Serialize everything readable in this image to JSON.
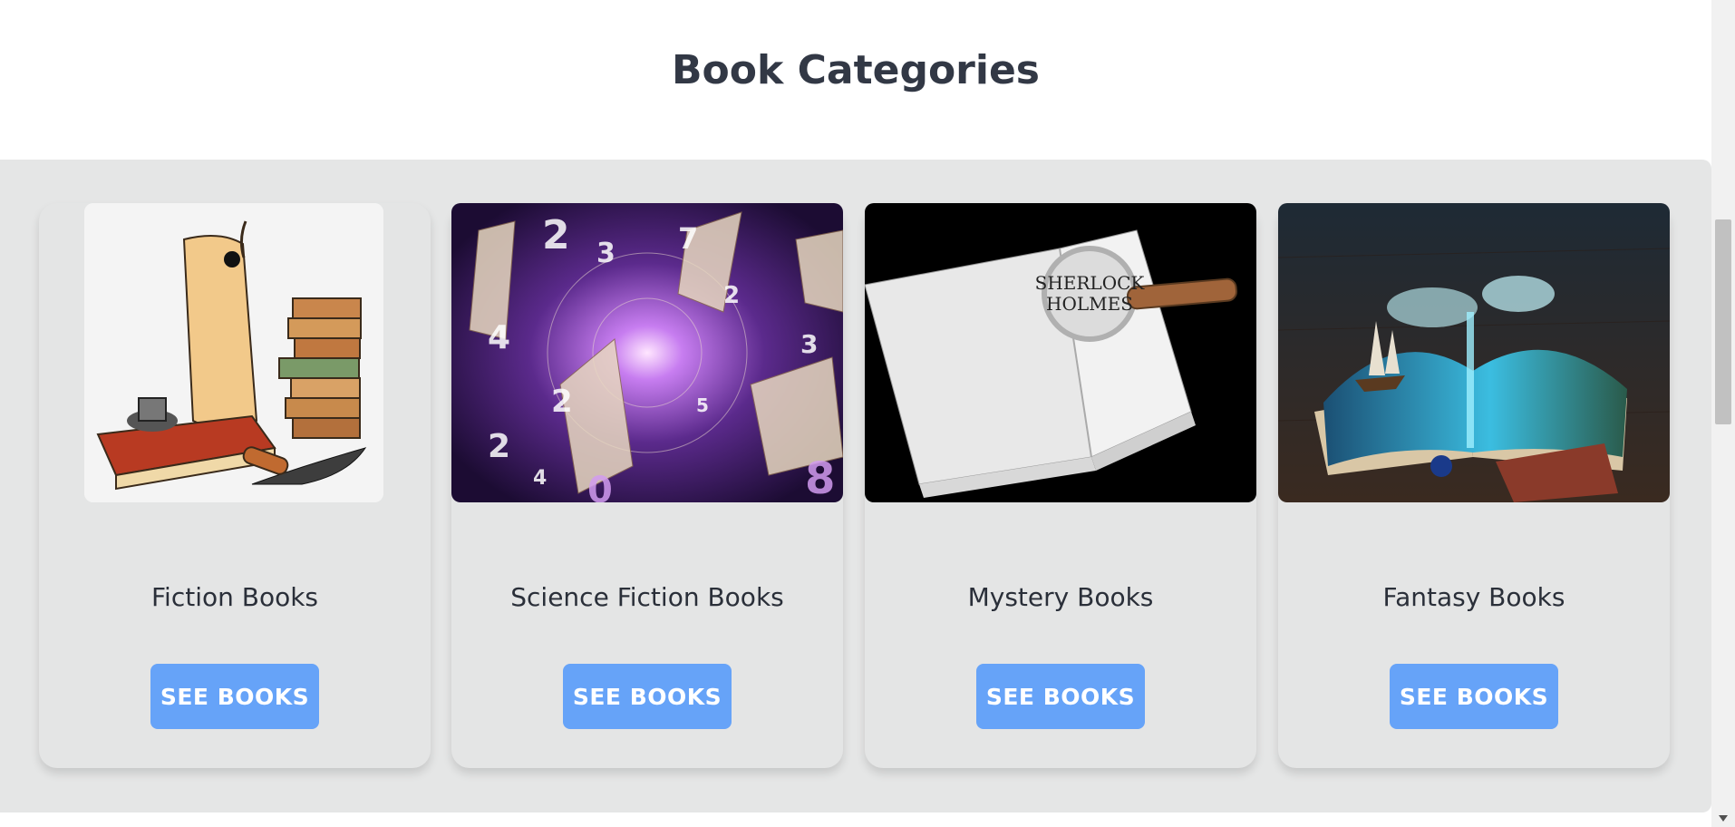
{
  "page": {
    "title": "Book Categories"
  },
  "categories": [
    {
      "title": "Fiction Books",
      "button_label": "SEE BOOKS",
      "image": "scroll-quill-books-illustration"
    },
    {
      "title": "Science Fiction Books",
      "button_label": "SEE BOOKS",
      "image": "flying-books-purple-numbers"
    },
    {
      "title": "Mystery Books",
      "button_label": "SEE BOOKS",
      "image": "sherlock-holmes-book-magnifier"
    },
    {
      "title": "Fantasy Books",
      "button_label": "SEE BOOKS",
      "image": "open-book-ocean-ship"
    }
  ],
  "colors": {
    "panel": "#e5e6e6",
    "button": "#66a3f8",
    "title_text": "#323845"
  }
}
